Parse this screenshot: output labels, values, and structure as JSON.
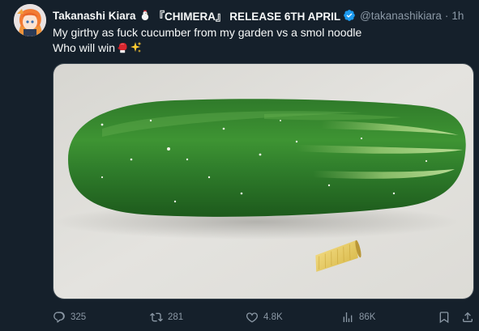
{
  "tweet": {
    "author": {
      "display_name": "Takanashi Kiara",
      "badge_text": "『CHIMERA』 RELEASE 6TH APRIL",
      "handle": "@takanashikiara",
      "separator": "·",
      "time": "1h",
      "verified": true,
      "name_emoji": "chicken-icon"
    },
    "text": {
      "line1": "My girthy as fuck cucumber from my garden vs a smol noodle",
      "line2": "Who will win",
      "emojis": [
        "boxing-glove-icon",
        "sparkles-icon"
      ]
    },
    "media": {
      "description_icon": "photo"
    },
    "actions": {
      "reply_count": "325",
      "retweet_count": "281",
      "like_count": "4.8K",
      "views_count": "86K"
    }
  },
  "colors": {
    "background": "#15202b",
    "text_primary": "#f7f9f9",
    "text_secondary": "#8b98a5",
    "verified": "#1d9bf0",
    "border": "#38444d"
  }
}
